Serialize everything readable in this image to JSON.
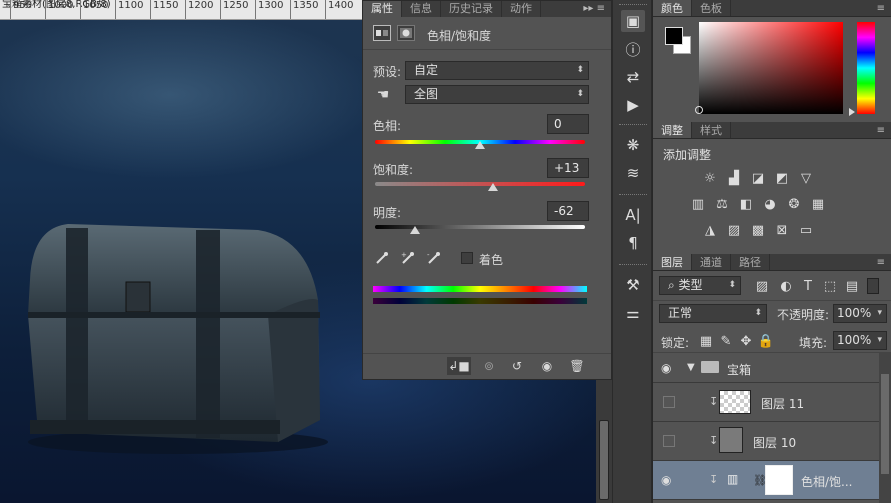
{
  "canvas": {
    "ruler_title": "宝箱素材(图层8,RGB/8)",
    "ruler_ticks": [
      "950",
      "1000",
      "1050",
      "1100",
      "1150",
      "1200",
      "1250",
      "1300",
      "1350",
      "1400"
    ]
  },
  "properties": {
    "tabs": [
      "属性",
      "信息",
      "历史记录",
      "动作"
    ],
    "menu_glyph": "▸▸ ≡",
    "title": "色相/饱和度",
    "preset_label": "预设:",
    "preset_value": "自定",
    "channel_value": "全图",
    "hue_label": "色相:",
    "hue_value": "0",
    "hue_level_percent": 50,
    "saturation_label": "饱和度:",
    "saturation_value": "+13",
    "saturation_level_percent": 56,
    "lightness_label": "明度:",
    "lightness_value": "-62",
    "lightness_level_percent": 19,
    "colorize_label": "着色"
  },
  "color_panel": {
    "tabs": [
      "颜色",
      "色板"
    ],
    "foreground": "#000000",
    "background": "#ffffff",
    "hue_color": "#ff0000"
  },
  "adjustments": {
    "tabs": [
      "调整",
      "样式"
    ],
    "heading": "添加调整"
  },
  "layers": {
    "tabs": [
      "图层",
      "通道",
      "路径"
    ],
    "filter_value": "类型",
    "blend_mode": "正常",
    "opacity_label": "不透明度:",
    "opacity_value": "100%",
    "lock_label": "锁定:",
    "fill_label": "填充:",
    "fill_value": "100%",
    "group_name": "宝箱",
    "items": [
      {
        "name": "图层 11",
        "visible": false
      },
      {
        "name": "图层 10",
        "visible": false
      },
      {
        "name": "色相/饱...",
        "visible": true
      }
    ]
  }
}
